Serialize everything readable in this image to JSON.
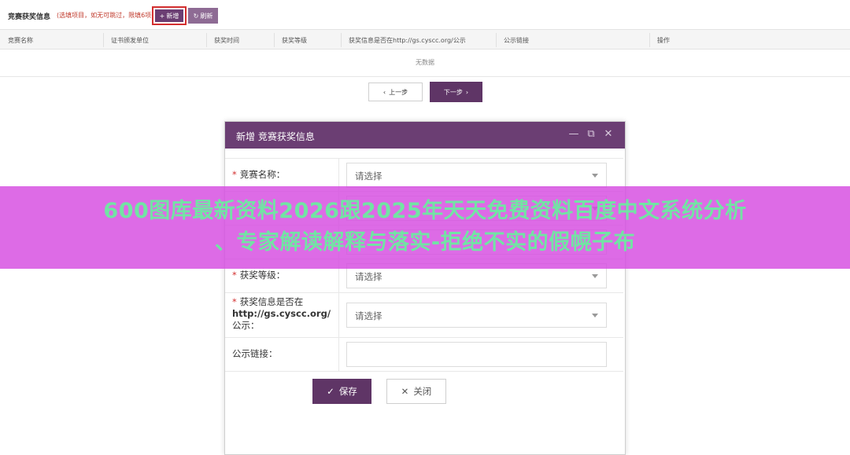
{
  "toolbar": {
    "title": "竞赛获奖信息",
    "hint": "(选填项目，如无可跳过，限填6项)",
    "add_label": "新增",
    "refresh_label": "刷新"
  },
  "table": {
    "columns": [
      "竞赛名称",
      "证书颁发单位",
      "获奖时间",
      "获奖等级",
      "获奖信息是否在http://gs.cyscc.org/公示",
      "公示链接",
      "操作"
    ],
    "empty_text": "无数据"
  },
  "pager": {
    "prev_label": "上一步",
    "next_label": "下一步"
  },
  "modal": {
    "title": "新增 竞赛获奖信息",
    "fields": {
      "competition_name": {
        "label": "竞赛名称：",
        "value": "请选择"
      },
      "award_level": {
        "label": "获奖等级：",
        "value": "请选择"
      },
      "publicity_line1": "获奖信息是否在",
      "publicity_line2": "http://gs.cyscc.org/",
      "publicity_line3": "公示：",
      "publicity_value": "请选择",
      "link_label": "公示链接："
    },
    "save_label": "保存",
    "close_label": "关闭"
  },
  "banner": {
    "line1": "600图库最新资料2026跟2025年天天免费资料百度中文系统分析",
    "line2": "、专家解读解释与落实-拒绝不实的假幌子布"
  },
  "colors": {
    "primary": "#6b3e73",
    "primary_dark": "#5f3566",
    "danger": "#d32f2f",
    "banner_bg": "#d64ae0",
    "banner_text": "#72e4a4"
  }
}
